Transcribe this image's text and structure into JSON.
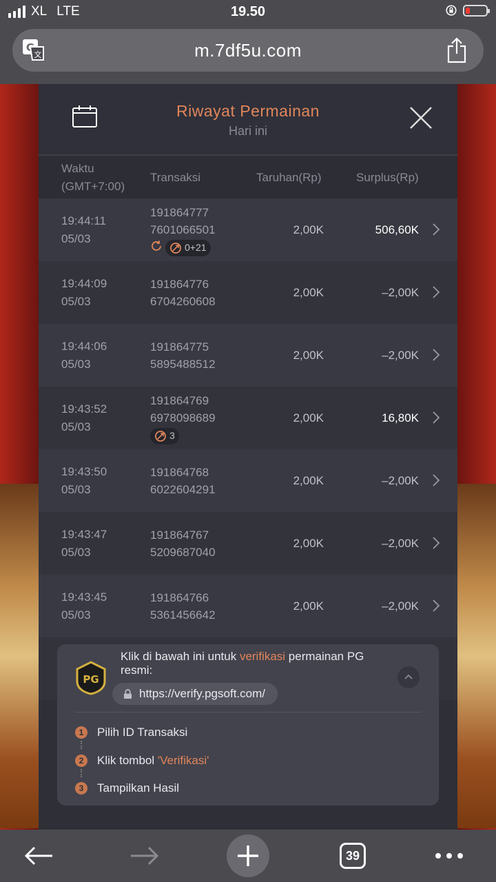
{
  "status_bar": {
    "carrier": "XL",
    "network": "LTE",
    "time": "19.50"
  },
  "browser": {
    "url": "m.7df5u.com",
    "tab_count": "39"
  },
  "header": {
    "title": "Riwayat Permainan",
    "subtitle": "Hari ini"
  },
  "columns": {
    "time_line1": "Waktu",
    "time_line2": "(GMT+7:00)",
    "transaction": "Transaksi",
    "bet": "Taruhan(Rp)",
    "surplus": "Surplus(Rp)"
  },
  "rows": [
    {
      "time": "19:44:11",
      "date": "05/03",
      "tx1": "191864777",
      "tx2": "7601066501",
      "bet": "2,00K",
      "surplus": "506,60K",
      "positive": true,
      "tag": "0+21"
    },
    {
      "time": "19:44:09",
      "date": "05/03",
      "tx1": "191864776",
      "tx2": "6704260608",
      "bet": "2,00K",
      "surplus": "–2,00K",
      "positive": false
    },
    {
      "time": "19:44:06",
      "date": "05/03",
      "tx1": "191864775",
      "tx2": "5895488512",
      "bet": "2,00K",
      "surplus": "–2,00K",
      "positive": false
    },
    {
      "time": "19:43:52",
      "date": "05/03",
      "tx1": "191864769",
      "tx2": "6978098689",
      "bet": "2,00K",
      "surplus": "16,80K",
      "positive": true,
      "tag": "3"
    },
    {
      "time": "19:43:50",
      "date": "05/03",
      "tx1": "191864768",
      "tx2": "6022604291",
      "bet": "2,00K",
      "surplus": "–2,00K",
      "positive": false
    },
    {
      "time": "19:43:47",
      "date": "05/03",
      "tx1": "191864767",
      "tx2": "5209687040",
      "bet": "2,00K",
      "surplus": "–2,00K",
      "positive": false
    },
    {
      "time": "19:43:45",
      "date": "05/03",
      "tx1": "191864766",
      "tx2": "5361456642",
      "bet": "2,00K",
      "surplus": "–2,00K",
      "positive": false
    }
  ],
  "verify": {
    "logo_text": "PG",
    "text_before": "Klik di bawah ini untuk ",
    "text_highlight": "verifikasi",
    "text_after": " permainan PG resmi:",
    "url": "https://verify.pgsoft.com/",
    "steps": [
      {
        "num": "1",
        "label": "Pilih ID Transaksi",
        "highlight": ""
      },
      {
        "num": "2",
        "label": "Klik tombol ",
        "highlight": "'Verifikasi'"
      },
      {
        "num": "3",
        "label": "Tampilkan Hasil",
        "highlight": ""
      }
    ]
  },
  "colors": {
    "accent": "#e0865a",
    "panel": "#2f2f37",
    "badge": "#c87850"
  }
}
